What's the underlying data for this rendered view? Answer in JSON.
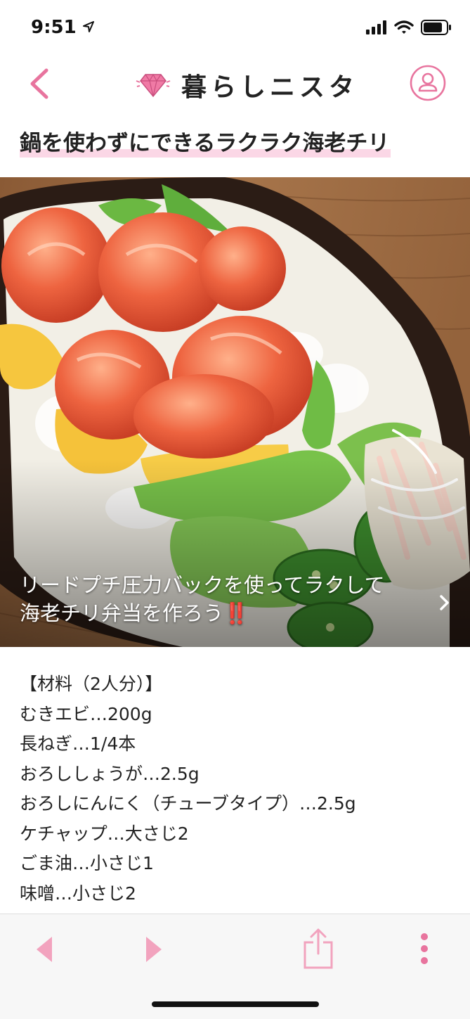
{
  "status": {
    "time": "9:51"
  },
  "header": {
    "logo_text": "暮らしニスタ"
  },
  "article": {
    "title": "鍋を使わずにできるラクラク海老チリ",
    "caption_line1": "リードプチ圧力バックを使ってラクして",
    "caption_line2": "海老チリ弁当を作ろう‼️"
  },
  "ingredients": {
    "heading": "【材料（2人分）】",
    "items": [
      "むきエビ…200g",
      "長ねぎ…1/4本",
      "おろししょうが…2.5g",
      "おろしにんにく（チューブタイプ）…2.5g",
      "ケチャップ…大さじ2",
      "ごま油…小さじ1",
      "味噌…小さじ2"
    ]
  },
  "colors": {
    "accent": "#e8749e",
    "toolbar_icon": "#f2a3be"
  },
  "icons": [
    "location-arrow-icon",
    "signal-icon",
    "wifi-icon",
    "battery-icon",
    "back-chevron-icon",
    "diamond-icon",
    "user-icon",
    "chevron-right-icon",
    "toolbar-back-icon",
    "toolbar-forward-icon",
    "share-icon",
    "more-icon"
  ]
}
